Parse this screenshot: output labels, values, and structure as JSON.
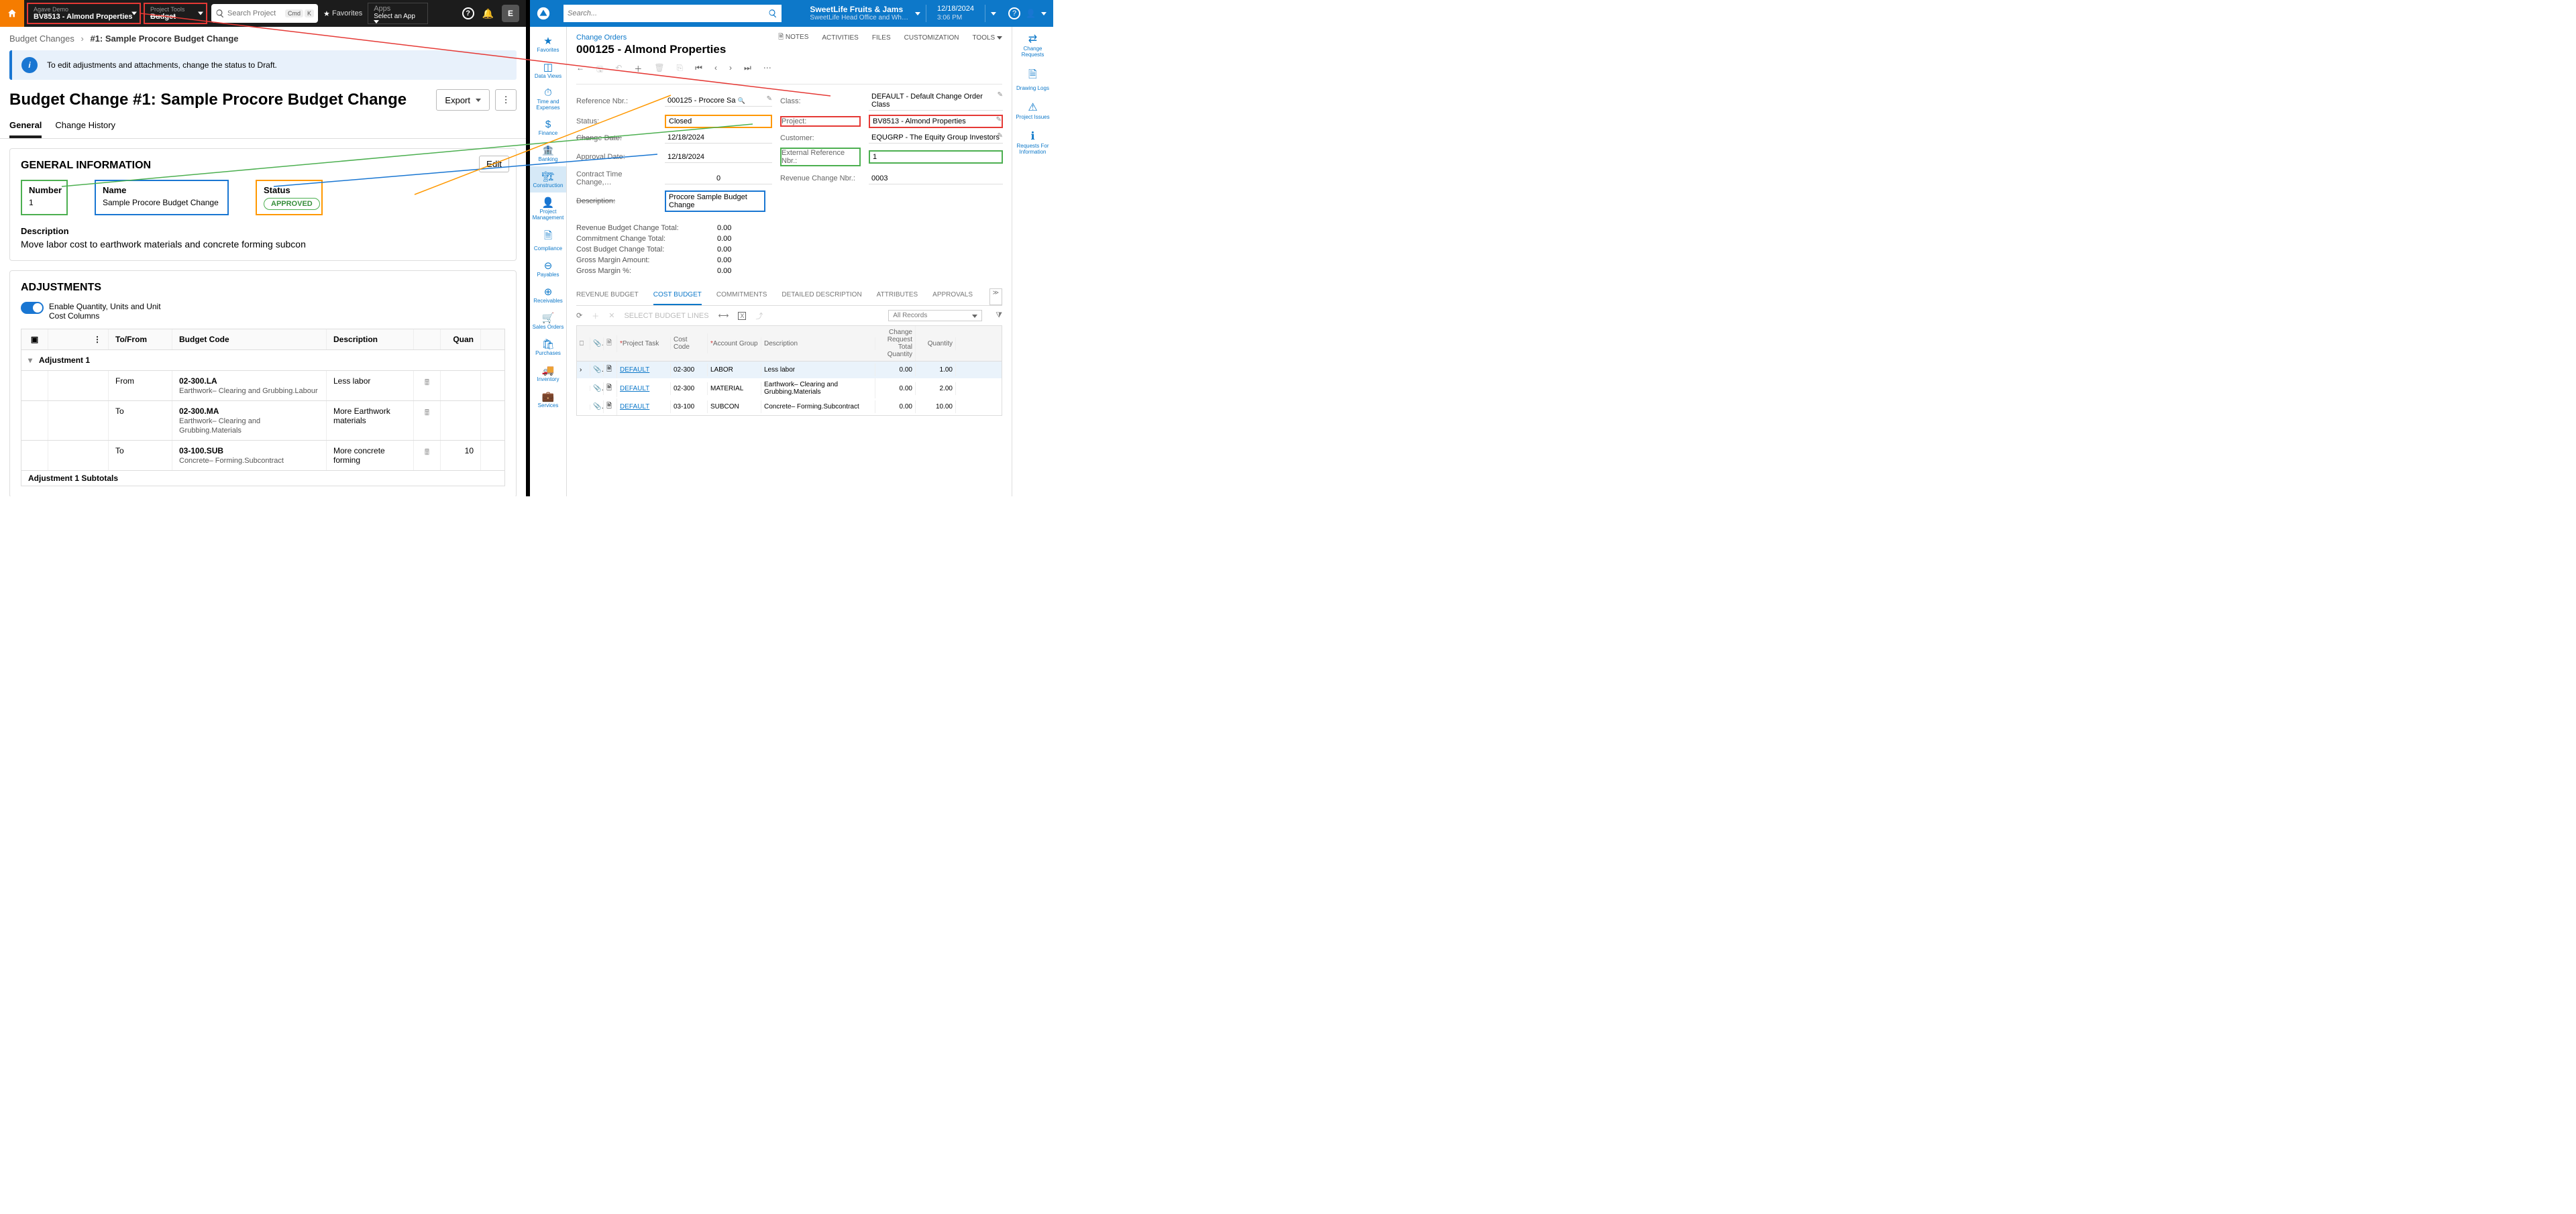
{
  "left": {
    "topnav": {
      "company": "Agave Demo",
      "project": "BV8513 - Almond Properties",
      "tools_label": "Project Tools",
      "tools_value": "Budget",
      "search_placeholder": "Search Project",
      "cmd": "Cmd",
      "k": "K",
      "favorites": "Favorites",
      "apps_label": "Apps",
      "apps_value": "Select an App",
      "avatar": "E"
    },
    "breadcrumb": {
      "root": "Budget Changes",
      "current": "#1: Sample Procore Budget Change"
    },
    "banner": "To edit adjustments and attachments, change the status to Draft.",
    "title": "Budget Change #1: Sample Procore Budget Change",
    "export": "Export",
    "tabs": {
      "general": "General",
      "history": "Change History"
    },
    "gi": {
      "heading": "GENERAL INFORMATION",
      "edit": "Edit",
      "number_label": "Number",
      "number_value": "1",
      "name_label": "Name",
      "name_value": "Sample Procore Budget Change",
      "status_label": "Status",
      "status_value": "APPROVED",
      "desc_label": "Description",
      "desc_value": "Move labor cost to earthwork materials and concrete forming subcon"
    },
    "adj": {
      "heading": "ADJUSTMENTS",
      "toggle_label": "Enable Quantity, Units and Unit Cost Columns",
      "cols": {
        "tofrom": "To/From",
        "code": "Budget Code",
        "desc": "Description",
        "qty": "Quan"
      },
      "group": "Adjustment 1",
      "rows": [
        {
          "tofrom": "From",
          "code": "02-300.LA",
          "code2": "Earthwork– Clearing and Grubbing.Labour",
          "desc": "Less labor"
        },
        {
          "tofrom": "To",
          "code": "02-300.MA",
          "code2": "Earthwork– Clearing and Grubbing.Materials",
          "desc": "More Earthwork materials"
        },
        {
          "tofrom": "To",
          "code": "03-100.SUB",
          "code2": "Concrete– Forming.Subcontract",
          "desc": "More concrete forming",
          "qty": "10"
        }
      ],
      "subtotal": "Adjustment 1 Subtotals"
    }
  },
  "right": {
    "topbar": {
      "search_placeholder": "Search...",
      "company": "SweetLife Fruits & Jams",
      "location": "SweetLife Head Office and Wh…",
      "date": "12/18/2024",
      "time": "3:06 PM"
    },
    "sidebar": [
      "Favorites",
      "Data Views",
      "Time and Expenses",
      "Finance",
      "Banking",
      "Construction",
      "Project Management",
      "Compliance",
      "Payables",
      "Receivables",
      "Sales Orders",
      "Purchases",
      "Inventory",
      "Services"
    ],
    "sidebar_r": [
      "Change Requests",
      "Drawing Logs",
      "Project Issues",
      "Requests For Information"
    ],
    "bc": "Change Orders",
    "title": "000125 - Almond Properties",
    "doc_tabs": [
      "NOTES",
      "ACTIVITIES",
      "FILES",
      "CUSTOMIZATION",
      "TOOLS"
    ],
    "form": {
      "ref_lbl": "Reference Nbr.:",
      "ref_val": "000125 - Procore Sa",
      "status_lbl": "Status:",
      "status_val": "Closed",
      "chdate_lbl": "Change Date:",
      "chdate_val": "12/18/2024",
      "appdate_lbl": "Approval Date:",
      "appdate_val": "12/18/2024",
      "cttime_lbl": "Contract Time Change,…",
      "cttime_val": "0",
      "desc_lbl": "Description:",
      "desc_val": "Procore Sample Budget Change",
      "class_lbl": "Class:",
      "class_val": "DEFAULT - Default Change Order Class",
      "proj_lbl": "Project:",
      "proj_val": "BV8513 - Almond Properties",
      "cust_lbl": "Customer:",
      "cust_val": "EQUGRP - The Equity Group Investors",
      "ext_lbl": "External Reference Nbr.:",
      "ext_val": "1",
      "rev_lbl": "Revenue Change Nbr.:",
      "rev_val": "0003"
    },
    "totals": [
      [
        "Revenue Budget Change Total:",
        "0.00"
      ],
      [
        "Commitment Change Total:",
        "0.00"
      ],
      [
        "Cost Budget Change Total:",
        "0.00"
      ],
      [
        "Gross Margin Amount:",
        "0.00"
      ],
      [
        "Gross Margin %:",
        "0.00"
      ]
    ],
    "rtabs": [
      "REVENUE BUDGET",
      "COST BUDGET",
      "COMMITMENTS",
      "DETAILED DESCRIPTION",
      "ATTRIBUTES",
      "APPROVALS"
    ],
    "select_lines": "SELECT BUDGET LINES",
    "all_records": "All Records",
    "gridcols": {
      "task": "Project Task",
      "cc": "Cost Code",
      "ag": "Account Group",
      "desc": "Description",
      "crtq": "Change Request Total Quantity",
      "qty": "Quantity"
    },
    "gridrows": [
      {
        "task": "DEFAULT",
        "cc": "02-300",
        "ag": "LABOR",
        "desc": "Less labor",
        "crtq": "0.00",
        "qty": "1.00"
      },
      {
        "task": "DEFAULT",
        "cc": "02-300",
        "ag": "MATERIAL",
        "desc": "Earthwork– Clearing and Grubbing.Materials",
        "crtq": "0.00",
        "qty": "2.00"
      },
      {
        "task": "DEFAULT",
        "cc": "03-100",
        "ag": "SUBCON",
        "desc": "Concrete– Forming.Subcontract",
        "crtq": "0.00",
        "qty": "10.00"
      }
    ]
  }
}
